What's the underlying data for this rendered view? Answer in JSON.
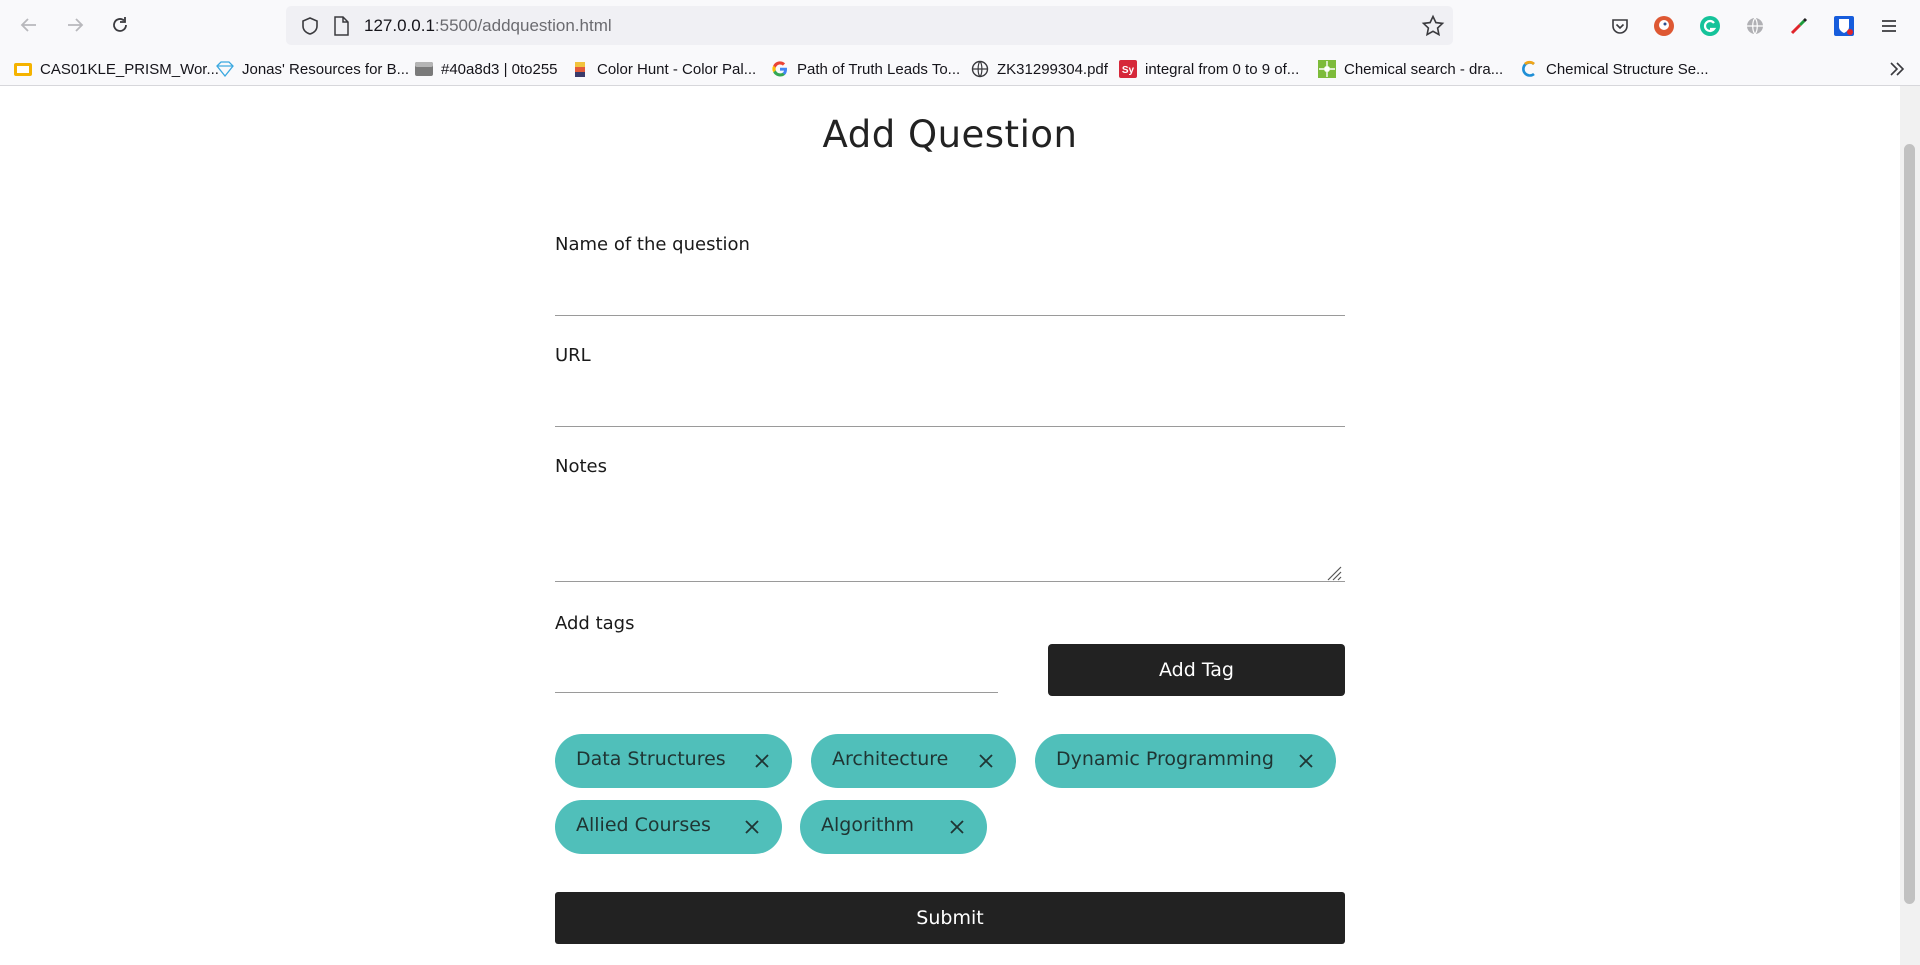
{
  "browser": {
    "url_host": "127.0.0.1",
    "url_path": ":5500/addquestion.html",
    "bookmarks": [
      {
        "label": "CAS01KLE_PRISM_Wor...",
        "icon": "folder-yellow-icon"
      },
      {
        "label": "Jonas' Resources for B...",
        "icon": "diamond-icon"
      },
      {
        "label": "#40a8d3 | 0to255",
        "icon": "color-swatch-icon"
      },
      {
        "label": "Color Hunt - Color Pal...",
        "icon": "color-hunt-icon"
      },
      {
        "label": "Path of Truth Leads To...",
        "icon": "google-icon"
      },
      {
        "label": "ZK31299304.pdf",
        "icon": "globe-icon"
      },
      {
        "label": "integral from 0 to 9 of...",
        "icon": "symbolab-icon"
      },
      {
        "label": "Chemical search - dra...",
        "icon": "molecule-icon"
      },
      {
        "label": "Chemical Structure Se...",
        "icon": "chemspider-icon"
      }
    ]
  },
  "form": {
    "title": "Add Question",
    "name_label": "Name of the question",
    "name_value": "",
    "url_label": "URL",
    "url_value": "",
    "notes_label": "Notes",
    "notes_value": "",
    "tags_label": "Add tags",
    "tag_value": "",
    "add_tag_button": "Add Tag",
    "tags": [
      {
        "label": "Data Structures"
      },
      {
        "label": "Architecture"
      },
      {
        "label": "Dynamic Programming"
      },
      {
        "label": "Allied Courses"
      },
      {
        "label": "Algorithm"
      }
    ],
    "submit_button": "Submit"
  },
  "colors": {
    "chip": "#50bfba",
    "button": "#222222"
  }
}
